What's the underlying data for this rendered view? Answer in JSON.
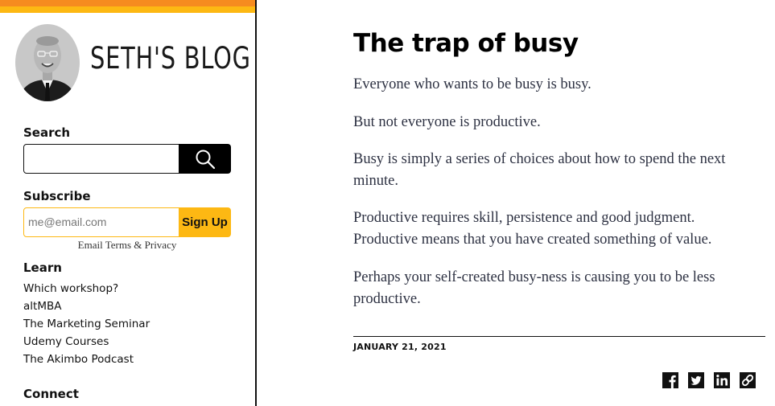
{
  "sidebar": {
    "blog_title": "SETH'S BLOG",
    "search": {
      "label": "Search",
      "value": ""
    },
    "subscribe": {
      "label": "Subscribe",
      "email_placeholder": "me@email.com",
      "button_label": "Sign Up",
      "terms_text": "Email Terms & Privacy"
    },
    "learn": {
      "label": "Learn",
      "items": [
        "Which workshop?",
        "altMBA",
        "The Marketing Seminar",
        "Udemy Courses",
        "The Akimbo Podcast"
      ]
    },
    "connect": {
      "label": "Connect"
    }
  },
  "post": {
    "title": "The trap of busy",
    "paragraphs": [
      "Everyone who wants to be busy is busy.",
      "But not everyone is productive.",
      "Busy is simply a series of choices about how to spend the next minute.",
      "Productive requires skill, persistence and good judgment. Productive means that you have created something of value.",
      "Perhaps your self-created busy-ness is causing you to be less productive."
    ],
    "date": "JANUARY 21, 2021"
  },
  "share": {
    "icons": [
      "facebook-icon",
      "twitter-icon",
      "linkedin-icon",
      "link-icon"
    ]
  },
  "colors": {
    "accent_orange": "#f68b1f",
    "accent_yellow": "#fdb813",
    "body_text": "#2d3142"
  }
}
